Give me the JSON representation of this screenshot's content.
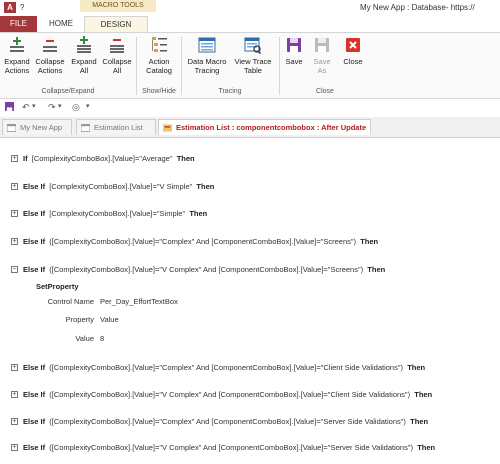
{
  "title_bar": {
    "macro_tools_label": "MACRO TOOLS",
    "window_title": "My New App : Database- https://"
  },
  "tabs": {
    "file": "FILE",
    "home": "HOME",
    "design": "DESIGN"
  },
  "ribbon": {
    "buttons": {
      "expand_actions": [
        "Expand",
        "Actions"
      ],
      "collapse_actions": [
        "Collapse",
        "Actions"
      ],
      "expand_all": [
        "Expand",
        "All"
      ],
      "collapse_all": [
        "Collapse",
        "All"
      ],
      "action_catalog": [
        "Action",
        "Catalog"
      ],
      "data_macro_tracing": [
        "Data Macro",
        "Tracing"
      ],
      "view_trace_table": [
        "View Trace",
        "Table"
      ],
      "save": [
        "Save"
      ],
      "save_as": [
        "Save",
        "As"
      ],
      "close": [
        "Close"
      ]
    },
    "groups": {
      "collapse_expand": "Collapse/Expand",
      "show_hide": "Show/Hide",
      "tracing": "Tracing",
      "close": "Close"
    },
    "colors": {
      "file_tab": "#a4373a",
      "design_tab": "#fbf5e3",
      "close_red": "#d9342b",
      "save_purple": "#7b3fa0"
    }
  },
  "document_tabs": [
    {
      "label": "My New App",
      "active": false
    },
    {
      "label": "Estimation List",
      "active": false
    },
    {
      "label": "Estimation List : componentcombobox : After Update",
      "active": true
    }
  ],
  "macro": {
    "lines": [
      {
        "keyword": "If",
        "condition": "[ComplexityComboBox].[Value]=\"Average\"",
        "then": "Then",
        "expanded": false
      },
      {
        "keyword": "Else If",
        "condition": "[ComplexityComboBox].[Value]=\"V Simple\"",
        "then": "Then",
        "expanded": false
      },
      {
        "keyword": "Else If",
        "condition": "[ComplexityComboBox].[Value]=\"Simple\"",
        "then": "Then",
        "expanded": false
      },
      {
        "keyword": "Else If",
        "condition": "([ComplexityComboBox].[Value]=\"Complex\" And [ComponentComboBox].[Value]=\"Screens\")",
        "then": "Then",
        "expanded": false
      },
      {
        "keyword": "Else If",
        "condition": "([ComplexityComboBox].[Value]=\"V Complex\" And [ComponentComboBox].[Value]=\"Screens\")",
        "then": "Then",
        "expanded": true
      },
      {
        "keyword": "Else If",
        "condition": "([ComplexityComboBox].[Value]=\"Complex\" And [ComponentComboBox].[Value]=\"Client Side Validations\")",
        "then": "Then",
        "expanded": false
      },
      {
        "keyword": "Else If",
        "condition": "([ComplexityComboBox].[Value]=\"V Complex\" And [ComponentComboBox].[Value]=\"Client Side Validations\")",
        "then": "Then",
        "expanded": false
      },
      {
        "keyword": "Else If",
        "condition": "([ComplexityComboBox].[Value]=\"Complex\" And [ComponentComboBox].[Value]=\"Server Side Validations\")",
        "then": "Then",
        "expanded": false
      },
      {
        "keyword": "Else If",
        "condition": "([ComplexityComboBox].[Value]=\"V Complex\" And [ComponentComboBox].[Value]=\"Server Side Validations\")",
        "then": "Then",
        "expanded": false
      }
    ],
    "set_property": {
      "action": "SetProperty",
      "control_name_label": "Control Name",
      "control_name_value": "Per_Day_EffortTextBox",
      "property_label": "Property",
      "property_value": "Value",
      "value_label": "Value",
      "value_value": "8"
    }
  }
}
